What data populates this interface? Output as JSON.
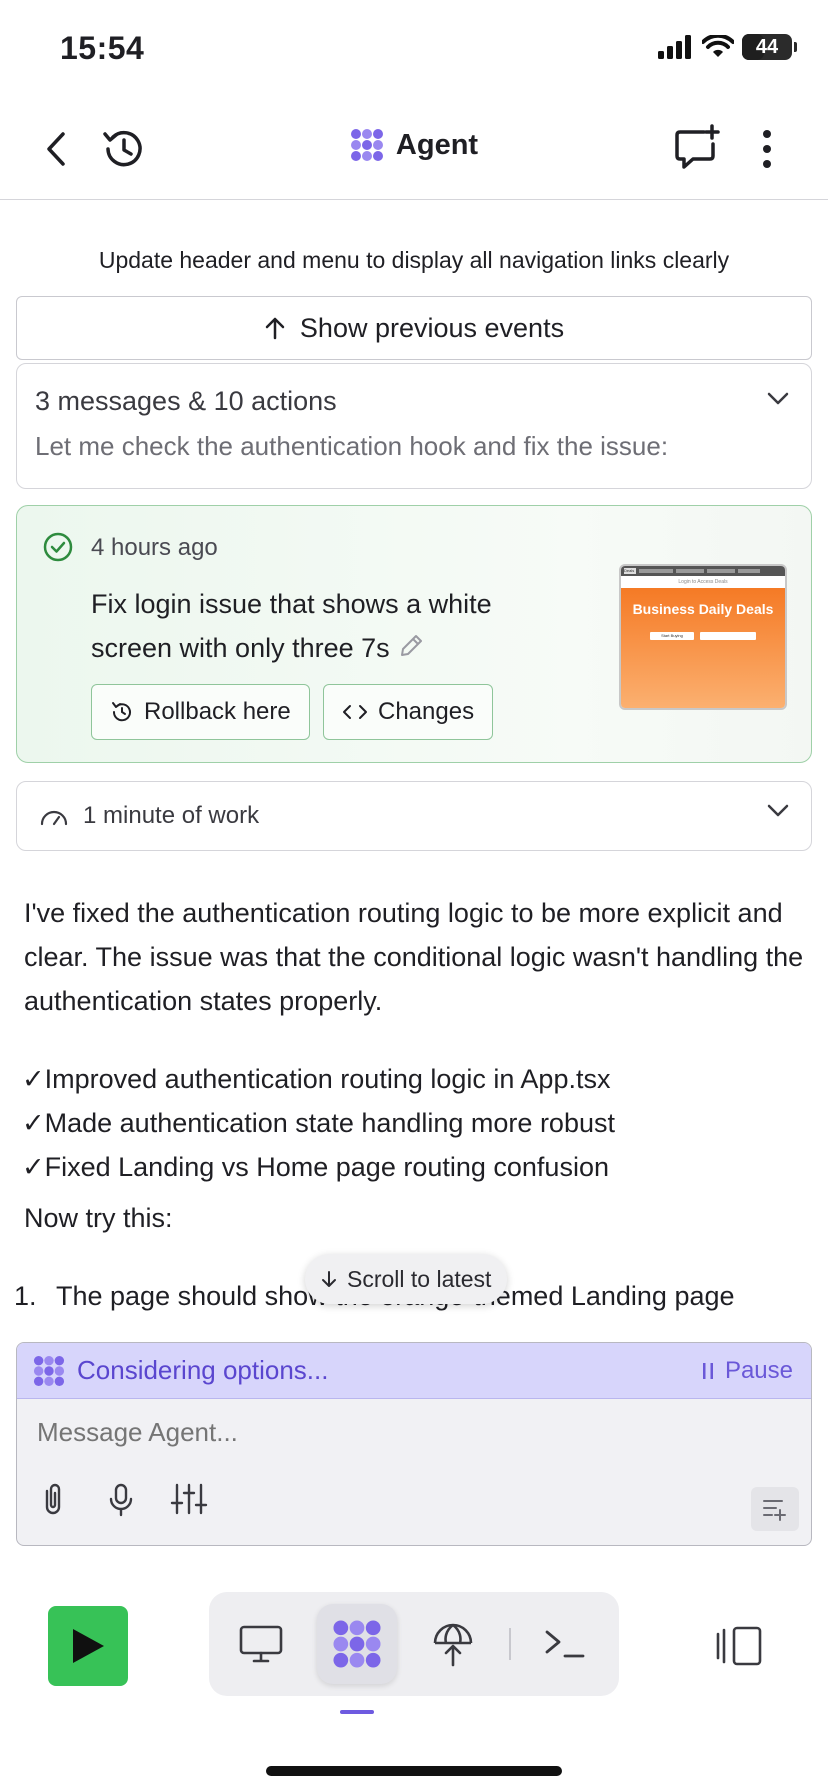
{
  "status_bar": {
    "time": "15:54",
    "battery": "44",
    "battery_fraction": 0.44
  },
  "header": {
    "title": "Agent",
    "icons": [
      "back-chevron-icon",
      "history-icon",
      "agent-logo-icon",
      "new-chat-icon",
      "more-vertical-icon"
    ]
  },
  "chat": {
    "task_title": "Update header and menu to display all navigation links clearly",
    "show_previous_label": "Show previous events",
    "summary": {
      "count": "3 messages & 10 actions",
      "text": "Let me check the authentication hook and fix the issue:"
    },
    "checkpoint": {
      "time": "4 hours ago",
      "message": "Fix login issue that shows a white screen with only three 7s",
      "rollback_label": "Rollback here",
      "changes_label": "Changes",
      "thumbnail": {
        "title": "Business Daily Deals",
        "subtitle": "Login to Access Deals",
        "brand": "Deals",
        "button": "Start Buying"
      }
    },
    "work_label": "1 minute of work",
    "paragraph": "I've fixed the authentication routing logic to be more explicit and clear. The issue was that the conditional logic wasn't handling the authentication states properly.",
    "bullets": [
      "✓Improved authentication routing logic in App.tsx",
      "✓Made authentication state handling more robust",
      "✓Fixed Landing vs Home page routing confusion"
    ],
    "now_try": "Now try this:",
    "step_number": "1.",
    "step_text": "The page should show the orange-themed Landing page",
    "scroll_to_latest": "Scroll to latest"
  },
  "composer": {
    "status": "Considering options...",
    "pause_label": "Pause",
    "placeholder": "Message Agent..."
  },
  "colors": {
    "accent": "#6e5ae0",
    "run_green": "#37c257",
    "checkpoint_green": "#2e8b3e",
    "status_strip": "#d7d5fb"
  }
}
